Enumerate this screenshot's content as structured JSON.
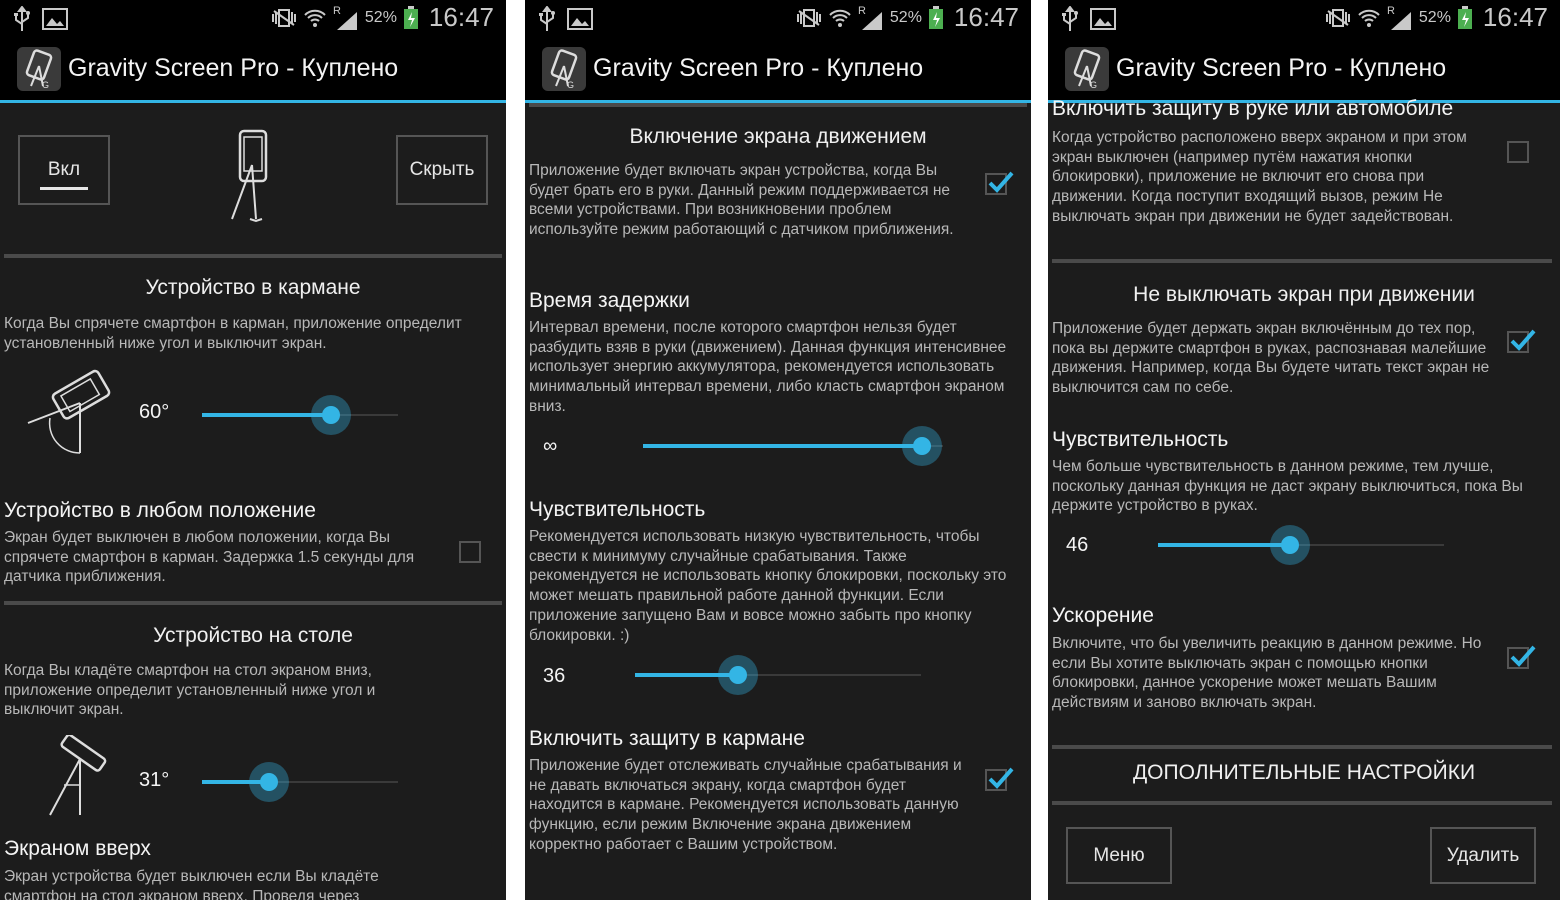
{
  "status_bar": {
    "battery": "52%",
    "time": "16:47",
    "network": "R"
  },
  "app": {
    "title": "Gravity Screen Pro - Куплено"
  },
  "screen1": {
    "on_button": "Вкл",
    "hide_button": "Скрыть",
    "pocket": {
      "title": "Устройство в кармане",
      "desc": "Когда Вы спрячете смартфон в карман, приложение определит установленный ниже угол и выключит экран.",
      "angle": "60°",
      "slider_fraction": 0.66
    },
    "any_position": {
      "title": "Устройство в любом положение",
      "desc": "Экран будет выключен в любом положении, когда Вы спрячете смартфон в карман. Задержка 1.5 секунды для датчика приближения.",
      "checked": false
    },
    "table": {
      "title": "Устройство на столе",
      "desc": "Когда Вы кладёте смартфон на стол экраном вниз, приложение определит установленный ниже угол и выключит экран.",
      "angle": "31°",
      "slider_fraction": 0.34
    },
    "face_up": {
      "title": "Экраном вверх",
      "desc": "Экран устройства будет выключен если Вы кладёте смартфон на стол экраном вверх. Проведя через"
    }
  },
  "screen2": {
    "motion_on": {
      "title": "Включение экрана движением",
      "desc": "Приложение будет включать экран устройства, когда Вы будет брать его в руки. Данный режим поддерживается не всеми устройствами. При возникновении проблем используйте режим работающий с датчиком приближения.",
      "checked": true
    },
    "delay": {
      "title": "Время задержки",
      "desc": "Интервал времени, после которого смартфон нельзя будет разбудить взяв в руки (движением). Данная функция интенсивнее использует энергию аккумулятора, рекомендуется использовать минимальный интервал времени, либо класть смартфон экраном вниз.",
      "value": "∞",
      "slider_fraction": 0.93
    },
    "sensitivity": {
      "title": "Чувствительность",
      "desc": "Рекомендуется использовать низкую чувствительность, чтобы свести к минимуму случайные срабатывания. Также рекомендуется не использовать кнопку блокировки, поскольку это может мешать правильной работе данной функции. Если приложение запущено Вам и вовсе можно забыть про кнопку блокировки. :)",
      "value": "36",
      "slider_fraction": 0.36
    },
    "pocket_protect": {
      "title": "Включить защиту в кармане",
      "desc": "Приложение будет отслеживать случайные срабатывания и не давать включаться экрану, когда смартфон будет находится в кармане. Рекомендуется использовать данную функцию, если режим Включение экрана движением корректно работает с Вашим устройством.",
      "checked": true
    }
  },
  "screen3": {
    "hand_car": {
      "title": "Включить защиту в руке или автомобиле",
      "desc": "Когда устройство расположено вверх экраном и при этом экран выключен (например путём нажатия кнопки блокировки), приложение не включит его снова при движении. Когда поступит входящий вызов, режим Не выключать экран при движении не будет задействован.",
      "checked": false
    },
    "keep_on": {
      "title": "Не выключать экран при движении",
      "desc": "Приложение будет держать экран включённым до тех пор, пока вы держите смартфон в руках, распознавая малейшие движения. Например, когда Вы будете читать текст экран не выключится сам по себе.",
      "checked": true
    },
    "sensitivity": {
      "title": "Чувствительность",
      "desc": "Чем больше чувствительность в данном режиме, тем лучше, поскольку данная функция не даст экрану выключиться, пока Вы держите устройство в руках.",
      "value": "46",
      "slider_fraction": 0.46
    },
    "acceleration": {
      "title": "Ускорение",
      "desc": "Включите, что бы увеличить реакцию в данном режиме. Но если Вы хотите выключать экран с помощью кнопки блокировки, данное ускорение может мешать Вашим действиям и заново включать экран.",
      "checked": true
    },
    "additional": "ДОПОЛНИТЕЛЬНЫЕ НАСТРОЙКИ",
    "menu_button": "Меню",
    "delete_button": "Удалить"
  },
  "colors": {
    "accent": "#33b5e5",
    "background": "#1c1c1c",
    "actionbar": "#000000"
  },
  "icons": [
    "usb-icon",
    "image-icon",
    "vibrate-icon",
    "wifi-icon",
    "signal-icon",
    "battery-icon",
    "app-icon",
    "phone-tilt-icon"
  ]
}
